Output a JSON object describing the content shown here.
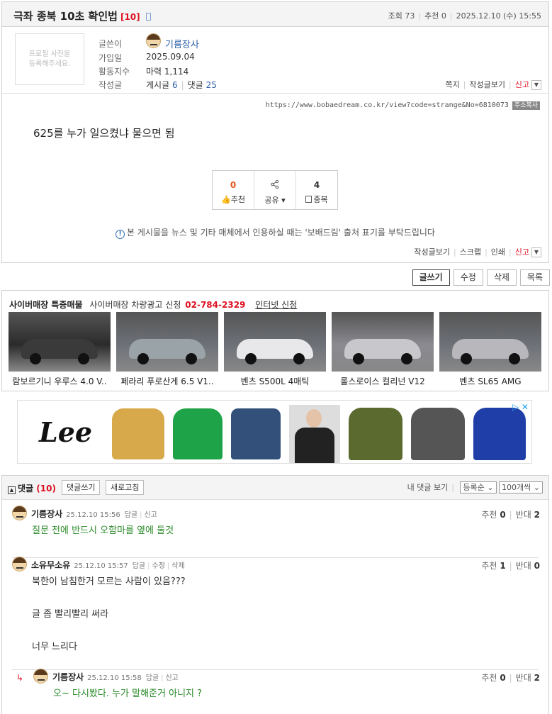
{
  "post": {
    "title": "극좌 종북 10초 확인법",
    "comment_count": "[10]",
    "views_label": "조회",
    "views": "73",
    "recommend_label": "추천",
    "recommend": "0",
    "date": "2025.12.10 (수) 15:55",
    "profile_placeholder": "프로필 사진을 등록해주세요.",
    "author_label": "글쓴이",
    "author": "기름장사",
    "joined_label": "가입일",
    "joined": "2025.09.04",
    "activity_label": "활동지수",
    "activity": "마력 1,114",
    "posts_label": "작성글",
    "posts_text": "게시글",
    "posts_count": "6",
    "replies_text": "댓글",
    "replies_count": "25",
    "top_links": [
      "쪽지",
      "작성글보기",
      "신고"
    ],
    "url": "https://www.bobaedream.co.kr/view?code=strange&No=6810073",
    "url_copy": "주소복사",
    "body": "625를 누가 일으켰냐 물으면 됨",
    "vote": {
      "recommend_count": "0",
      "recommend_label": "추천",
      "share_label": "공유",
      "duplicate_count": "4",
      "duplicate_label": "중복"
    },
    "notice": "본 게시물을 뉴스 및 기타 매체에서 인용하실 때는 '보배드림' 출처 표기를 부탁드립니다",
    "bottom_links": [
      "작성글보기",
      "스크랩",
      "인쇄",
      "신고"
    ]
  },
  "buttons": [
    "글쓰기",
    "수정",
    "삭제",
    "목록"
  ],
  "store": {
    "title": "사이버매장 특증매물",
    "ad_label": "사이버매장 차량광고 신청",
    "phone": "02-784-2329",
    "online_label": "인터넷 신청",
    "cars": [
      {
        "name": "람보르기니 우루스 4.0 V..",
        "color": "#3a3a3a"
      },
      {
        "name": "페라리 푸로산게 6.5 V1..",
        "color": "#9aa3a8"
      },
      {
        "name": "벤츠 S500L 4매틱",
        "color": "#e8e8ea"
      },
      {
        "name": "롤스로이스 컬리넌 V12",
        "color": "#c8c8cc"
      },
      {
        "name": "벤츠 SL65 AMG",
        "color": "#b8b8bc"
      }
    ]
  },
  "ad": {
    "brand": "Lee"
  },
  "comments": {
    "title": "댓글",
    "count": "(10)",
    "write_btn": "댓글쓰기",
    "refresh_btn": "새로고침",
    "my_comments": "내 댓글 보기",
    "sort": "등록순",
    "per_page": "100개씩",
    "items": [
      {
        "name": "기름장사",
        "time": "25.12.10 15:56",
        "links": [
          "답글",
          "신고"
        ],
        "rec": "0",
        "opp": "2",
        "lines": [
          "질문 전에 반드시 오함마를 옆에 둘것"
        ],
        "color": "#2a8a2a"
      },
      {
        "name": "소유무소유",
        "time": "25.12.10 15:57",
        "links": [
          "답글",
          "수정",
          "삭제"
        ],
        "rec": "1",
        "opp": "0",
        "lines": [
          "북한이 남침한거 모르는 사람이 있음???",
          "글 좀 빨리빨리 써라",
          "너무 느리다"
        ],
        "color": "#333333"
      },
      {
        "name": "기름장사",
        "time": "25.12.10 15:58",
        "links": [
          "답글",
          "신고"
        ],
        "rec": "0",
        "opp": "2",
        "lines": [
          "오~ 다시봤다. 누가 말해준거 아니지 ?"
        ],
        "color": "#2a8a2a"
      }
    ],
    "rec_label": "추천",
    "opp_label": "반대"
  }
}
